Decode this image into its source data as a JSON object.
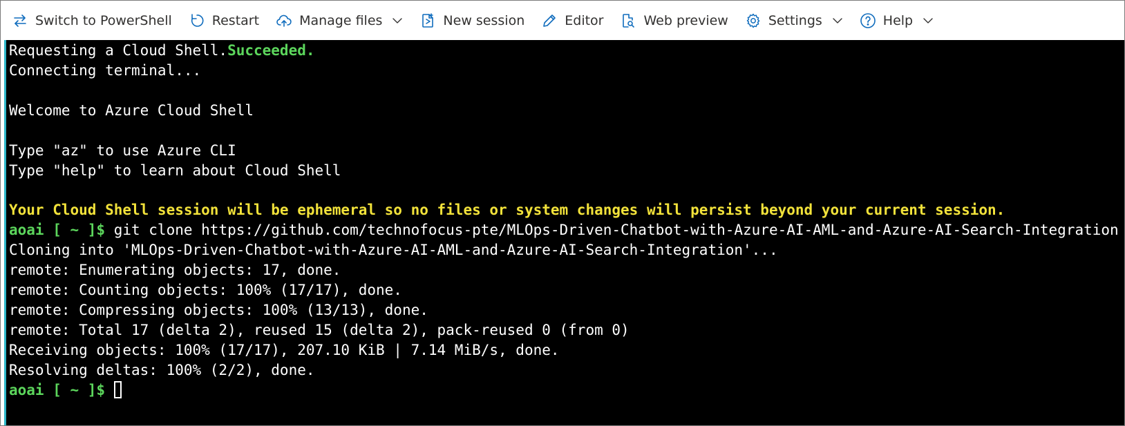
{
  "toolbar": {
    "switch_shell": "Switch to PowerShell",
    "restart": "Restart",
    "manage_files": "Manage files",
    "new_session": "New session",
    "editor": "Editor",
    "web_preview": "Web preview",
    "settings": "Settings",
    "help": "Help"
  },
  "colors": {
    "accent_icon": "#0f6cbd",
    "success_green": "#5cd65c",
    "warning_yellow": "#f2e23a",
    "terminal_bg": "#000000"
  },
  "terminal": {
    "line1_prefix": "Requesting a Cloud Shell.",
    "line1_status": "Succeeded.",
    "line2": "Connecting terminal...",
    "line4": "Welcome to Azure Cloud Shell",
    "line6": "Type \"az\" to use Azure CLI",
    "line7": "Type \"help\" to learn about Cloud Shell",
    "line9_warning": "Your Cloud Shell session will be ephemeral so no files or system changes will persist beyond your current session.",
    "prompt": "aoai [ ~ ]$",
    "command": " git clone https://github.com/technofocus-pte/MLOps-Driven-Chatbot-with-Azure-AI-AML-and-Azure-AI-Search-Integration.git",
    "out1": "Cloning into 'MLOps-Driven-Chatbot-with-Azure-AI-AML-and-Azure-AI-Search-Integration'...",
    "out2": "remote: Enumerating objects: 17, done.",
    "out3": "remote: Counting objects: 100% (17/17), done.",
    "out4": "remote: Compressing objects: 100% (13/13), done.",
    "out5": "remote: Total 17 (delta 2), reused 15 (delta 2), pack-reused 0 (from 0)",
    "out6": "Receiving objects: 100% (17/17), 207.10 KiB | 7.14 MiB/s, done.",
    "out7": "Resolving deltas: 100% (2/2), done.",
    "prompt2": "aoai [ ~ ]$"
  }
}
